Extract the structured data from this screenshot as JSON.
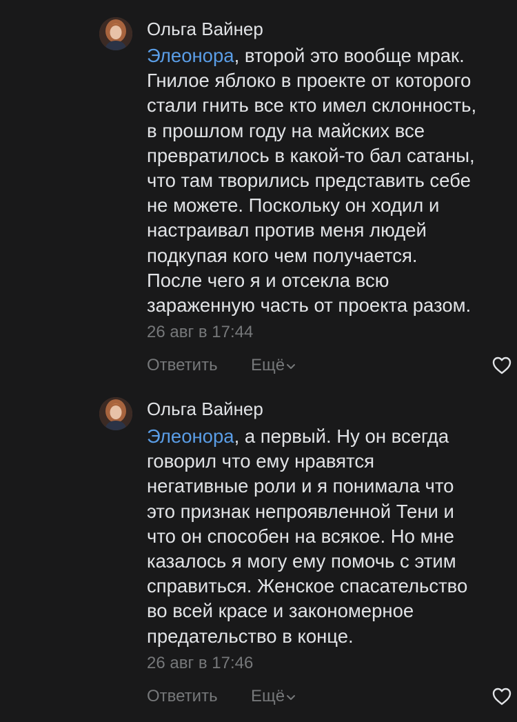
{
  "comments": [
    {
      "author": "Ольга Вайнер",
      "mention": "Элеонора",
      "lines": [
        ", второй это вообще мрак.",
        "Гнилое яблоко в проекте от которого",
        "стали гнить все кто имел склонность,",
        "в прошлом году на майских все",
        "превратилось в какой-то бал сатаны,",
        "что там творились представить себе",
        "не можете. Поскольку он ходил и",
        "настраивал против меня людей",
        "подкупая кого чем получается.",
        "После чего я и отсекла всю",
        "зараженную часть от проекта разом."
      ],
      "time": "26 авг в 17:44",
      "reply_label": "Ответить",
      "more_label": "Ещё"
    },
    {
      "author": "Ольга Вайнер",
      "mention": "Элеонора",
      "lines": [
        ", а первый. Ну он всегда",
        "говорил что ему нравятся",
        "негативные роли и я понимала что",
        "это признак непроявленной Тени и",
        "что он способен на всякое. Но мне",
        "казалось я могу ему помочь с этим",
        "справиться. Женское спасательство",
        "во всей красе и закономерное",
        "предательство в конце."
      ],
      "time": "26 авг в 17:46",
      "reply_label": "Ответить",
      "more_label": "Ещё"
    }
  ],
  "colors": {
    "background": "#19191a",
    "text": "#e1e3e6",
    "secondary": "#76787a",
    "mention": "#5a9de6"
  },
  "icons": {
    "avatar": "avatar-photo",
    "more": "chevron-down-icon",
    "like": "heart-outline-icon"
  }
}
